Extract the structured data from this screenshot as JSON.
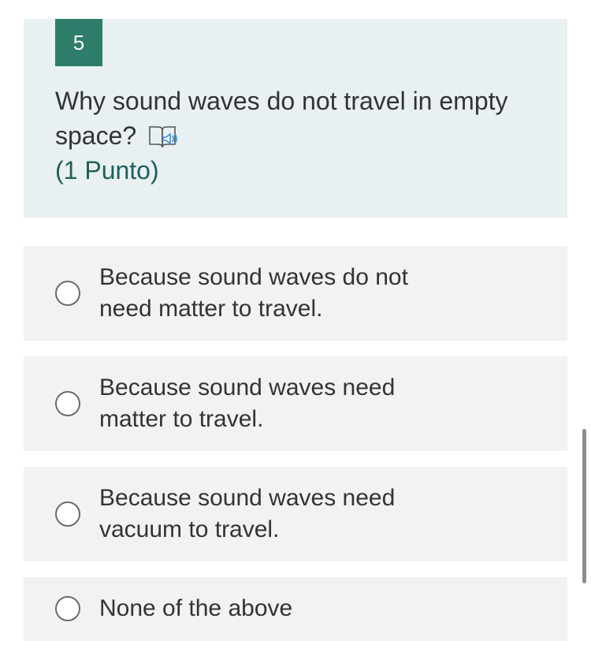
{
  "question": {
    "number": "5",
    "text": "Why sound waves do not travel in empty space?",
    "points": "(1 Punto)",
    "reader_icon": "immersive-reader-icon"
  },
  "options": [
    {
      "label": "Because sound waves do not need matter to travel.",
      "selected": false
    },
    {
      "label": "Because sound waves need matter to travel.",
      "selected": false
    },
    {
      "label": "Because sound waves need vacuum to travel.",
      "selected": false
    },
    {
      "label": "None of the above",
      "selected": false
    }
  ],
  "colors": {
    "accent": "#2e7d6b",
    "question_bg": "#e8f0f2",
    "option_bg": "#f2f2f2",
    "points_text": "#1f5f5b"
  }
}
